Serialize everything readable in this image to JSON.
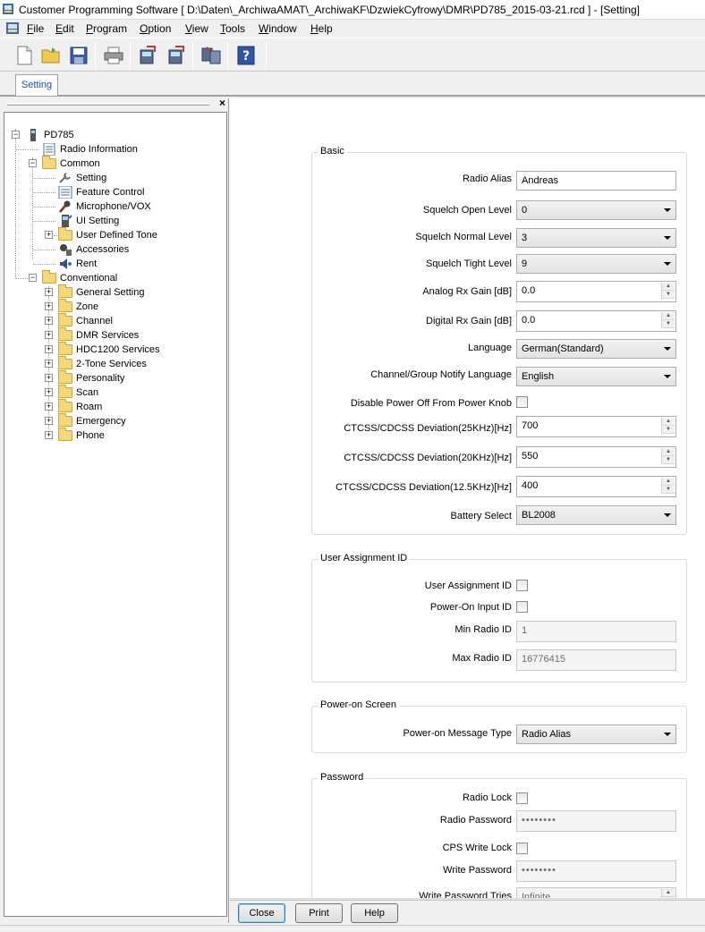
{
  "window": {
    "title": "Customer Programming Software [ D:\\Daten\\_ArchiwaAMAT\\_ArchiwaKF\\DzwiekCyfrowy\\DMR\\PD785_2015-03-21.rcd ] - [Setting]"
  },
  "menu": [
    {
      "label": "File",
      "accel": "F",
      "rest": "ile"
    },
    {
      "label": "Edit",
      "accel": "E",
      "rest": "dit"
    },
    {
      "label": "Program",
      "accel": "P",
      "rest": "rogram"
    },
    {
      "label": "Option",
      "accel": "O",
      "rest": "ption"
    },
    {
      "label": "View",
      "accel": "V",
      "rest": "iew"
    },
    {
      "label": "Tools",
      "accel": "T",
      "rest": "ools"
    },
    {
      "label": "Window",
      "accel": "W",
      "rest": "indow"
    },
    {
      "label": "Help",
      "accel": "H",
      "rest": "elp"
    }
  ],
  "toolbar": {
    "icons": [
      "new-file-icon",
      "open-folder-icon",
      "save-icon",
      "print-icon",
      "read-radio-icon",
      "write-radio-icon",
      "clone-icon",
      "help-icon"
    ]
  },
  "tabs": {
    "active": "Setting"
  },
  "tree": {
    "root": "PD785",
    "radio_information": "Radio Information",
    "common": "Common",
    "common_children": [
      "Setting",
      "Feature Control",
      "Microphone/VOX",
      "UI Setting",
      "User Defined Tone",
      "Accessories",
      "Rent"
    ],
    "conventional": "Conventional",
    "conventional_children": [
      "General Setting",
      "Zone",
      "Channel",
      "DMR Services",
      "HDC1200 Services",
      "2-Tone Services",
      "Personality",
      "Scan",
      "Roam",
      "Emergency",
      "Phone"
    ]
  },
  "basic": {
    "title": "Basic",
    "radio_alias_label": "Radio Alias",
    "radio_alias": "Andreas",
    "squelch_open_label": "Squelch Open Level",
    "squelch_open": "0",
    "squelch_normal_label": "Squelch Normal Level",
    "squelch_normal": "3",
    "squelch_tight_label": "Squelch Tight Level",
    "squelch_tight": "9",
    "analog_rx_gain_label": "Analog Rx Gain [dB]",
    "analog_rx_gain": "0.0",
    "digital_rx_gain_label": "Digital Rx Gain [dB]",
    "digital_rx_gain": "0.0",
    "language_label": "Language",
    "language": "German(Standard)",
    "notify_language_label": "Channel/Group Notify Language",
    "notify_language": "English",
    "disable_power_off_label": "Disable Power Off From Power Knob",
    "dev25_label": "CTCSS/CDCSS Deviation(25KHz)[Hz]",
    "dev25": "700",
    "dev20_label": "CTCSS/CDCSS Deviation(20KHz)[Hz]",
    "dev20": "550",
    "dev125_label": "CTCSS/CDCSS Deviation(12.5KHz)[Hz]",
    "dev125": "400",
    "battery_label": "Battery Select",
    "battery": "BL2008"
  },
  "user_assignment": {
    "title": "User Assignment ID",
    "user_assignment_id_label": "User Assignment ID",
    "power_on_input_label": "Power-On Input ID",
    "min_radio_id_label": "Min Radio ID",
    "min_radio_id": "1",
    "max_radio_id_label": "Max Radio ID",
    "max_radio_id": "16776415"
  },
  "power_on_screen": {
    "title": "Power-on Screen",
    "message_type_label": "Power-on Message Type",
    "message_type": "Radio Alias"
  },
  "password": {
    "title": "Password",
    "radio_lock_label": "Radio Lock",
    "radio_password_label": "Radio Password",
    "radio_password": "••••••••",
    "cps_write_lock_label": "CPS Write Lock",
    "write_password_label": "Write Password",
    "write_password": "••••••••",
    "write_password_tries_label": "Write Password Tries",
    "write_password_tries": "Infinite"
  },
  "buttons": {
    "close": "Close",
    "print": "Print",
    "help": "Help"
  }
}
